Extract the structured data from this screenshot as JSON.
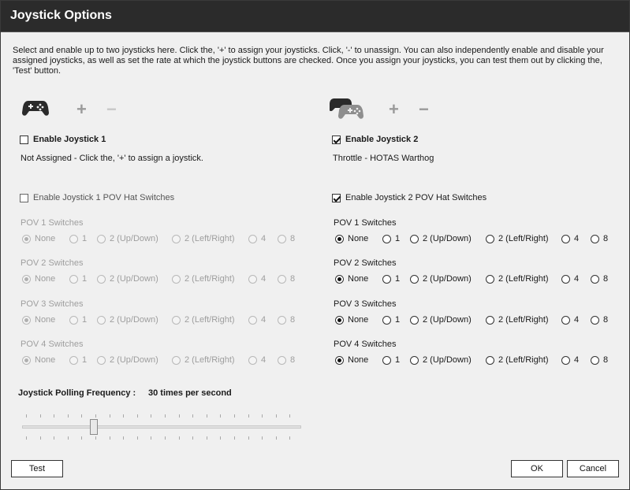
{
  "window": {
    "title": "Joystick Options"
  },
  "intro": "Select and enable up to two joysticks here.  Click the, '+' to assign your joysticks.  Click, '-' to unassign.  You can also independently enable and disable your assigned joysticks, as well as set the rate at which the joystick buttons are checked.  Once you assign your joysticks, you can test them out by clicking the, 'Test' button.",
  "joystick1": {
    "icon": "gamepad-icon",
    "plus": "+",
    "minus": "−",
    "enable_label": "Enable Joystick 1",
    "enabled": false,
    "status": "Not Assigned - Click the, '+' to assign a joystick.",
    "pov_enable_label": "Enable Joystick 1 POV Hat Switches",
    "pov_enabled": false,
    "povs": [
      {
        "label": "POV 1 Switches",
        "selected": "None"
      },
      {
        "label": "POV 2 Switches",
        "selected": "None"
      },
      {
        "label": "POV 3 Switches",
        "selected": "None"
      },
      {
        "label": "POV 4 Switches",
        "selected": "None"
      }
    ]
  },
  "joystick2": {
    "icon": "dual-gamepad-icon",
    "plus": "+",
    "minus": "−",
    "enable_label": "Enable Joystick 2",
    "enabled": true,
    "status": "Throttle - HOTAS Warthog",
    "pov_enable_label": "Enable Joystick 2 POV Hat Switches",
    "pov_enabled": true,
    "povs": [
      {
        "label": "POV 1 Switches",
        "selected": "None"
      },
      {
        "label": "POV 2 Switches",
        "selected": "None"
      },
      {
        "label": "POV 3 Switches",
        "selected": "None"
      },
      {
        "label": "POV 4 Switches",
        "selected": "None"
      }
    ]
  },
  "pov_options": [
    "None",
    "1",
    "2 (Up/Down)",
    "2 (Left/Right)",
    "4",
    "8"
  ],
  "polling": {
    "label": "Joystick Polling Frequency :",
    "value": "30 times per second"
  },
  "buttons": {
    "test": "Test",
    "ok": "OK",
    "cancel": "Cancel"
  },
  "colors": {
    "titlebar": "#2b2b2b",
    "dialog_bg": "#f0f0f0",
    "disabled_text": "#9e9e9e"
  }
}
